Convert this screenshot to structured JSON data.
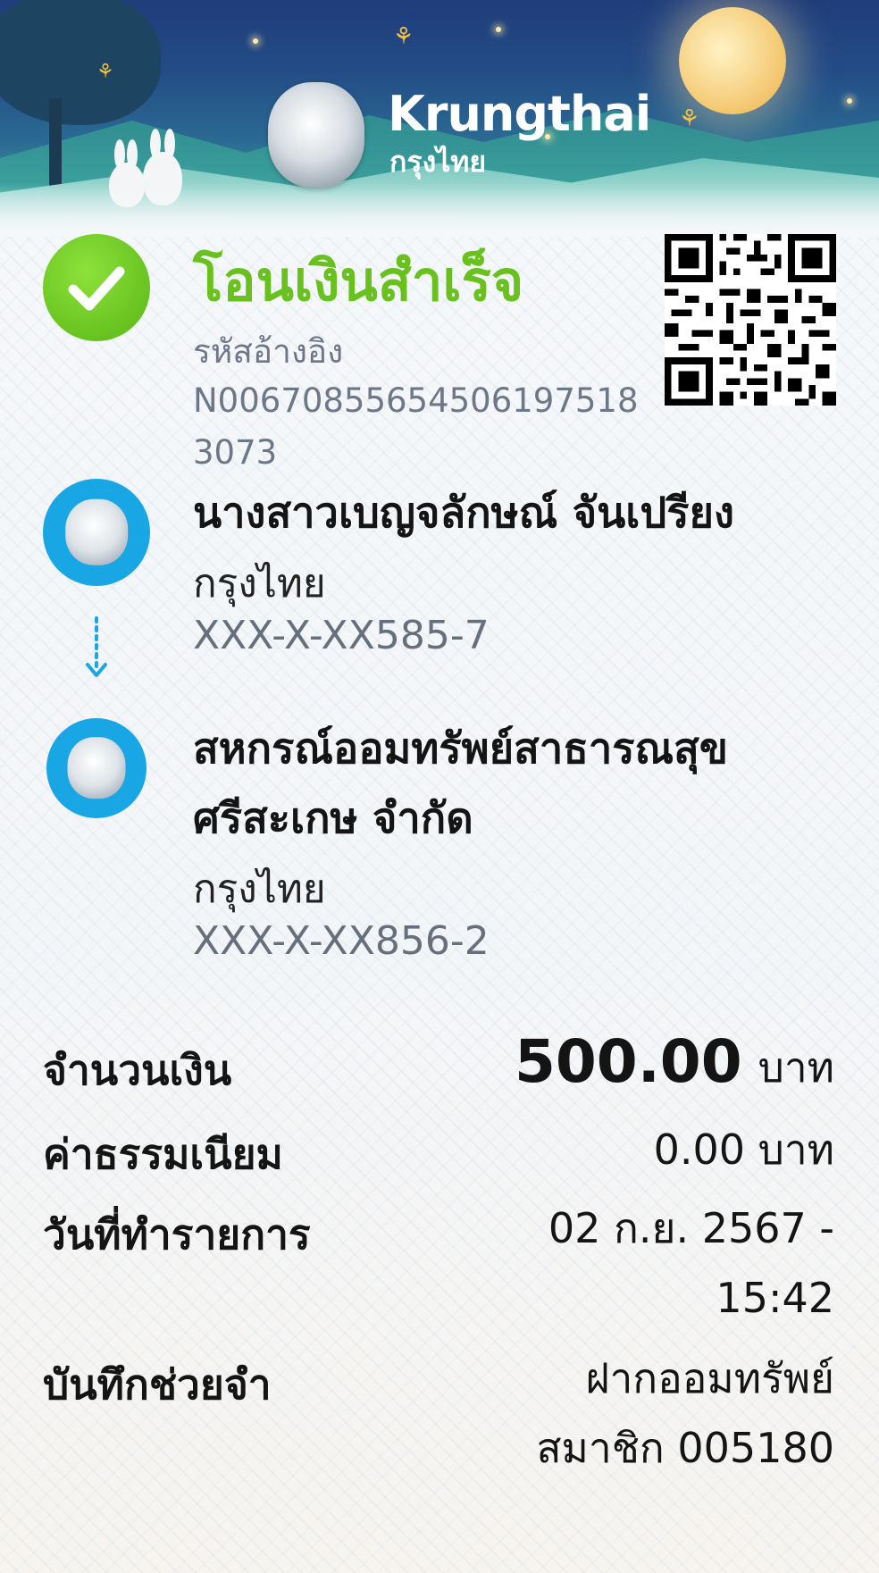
{
  "banner": {
    "brand_en": "Krungthai",
    "brand_th": "กรุงไทย"
  },
  "status": {
    "title": "โอนเงินสำเร็จ",
    "ref_label": "รหัสอ้างอิง",
    "ref_value": "N006708556545061975183073"
  },
  "sender": {
    "name": "นางสาวเบญจลักษณ์ จันเปรียง",
    "bank": "กรุงไทย",
    "account": "XXX-X-XX585-7"
  },
  "receiver": {
    "name_line1": "สหกรณ์ออมทรัพย์สาธารณสุข",
    "name_line2": "ศรีสะเกษ จำกัด",
    "bank": "กรุงไทย",
    "account": "XXX-X-XX856-2"
  },
  "details": {
    "amount_label": "จำนวนเงิน",
    "amount_value": "500.00",
    "amount_unit": "บาท",
    "fee_label": "ค่าธรรมเนียม",
    "fee_value": "0.00 บาท",
    "date_label": "วันที่ทำรายการ",
    "date_line1": "02 ก.ย. 2567 -",
    "date_line2": "15:42",
    "memo_label": "บันทึกช่วยจำ",
    "memo_line1": "ฝากออมทรัพย์",
    "memo_line2": "สมาชิก 005180"
  },
  "colors": {
    "success": "#69c11e",
    "bank_blue": "#18a6e4",
    "muted": "#6c7788"
  },
  "icons": [
    "check-icon",
    "qr-code",
    "krungthai-logo-icon",
    "arrow-down-icon"
  ]
}
